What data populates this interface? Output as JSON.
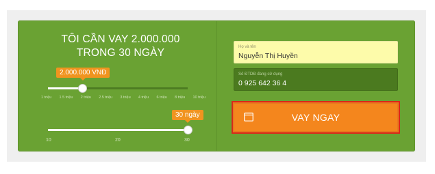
{
  "heading": {
    "line1": "TÔI CẦN VAY 2.000.000",
    "line2": "TRONG 30 NGÀY"
  },
  "amount_slider": {
    "bubble": "2.000.000 VNĐ",
    "ticks": [
      "1 triệu",
      "1.5 triệu",
      "2 triệu",
      "2.5 triệu",
      "3 triệu",
      "4 triệu",
      "6 triệu",
      "8 triệu",
      "10 triệu"
    ],
    "selected_index": 2
  },
  "days_slider": {
    "bubble": "30 ngày",
    "scale_labels": [
      "10",
      "20",
      "30"
    ],
    "level": 1.0
  },
  "form": {
    "name": {
      "label": "Họ và tên",
      "value": "Nguyễn Thị Huyền"
    },
    "phone": {
      "label": "Số ĐTDĐ đang sử dụng",
      "value": "0 925 642 36 4"
    },
    "submit_label": "VAY NGAY"
  },
  "colors": {
    "panel": "#6aa233",
    "accent": "#f4861d",
    "highlight_border": "#d9281a",
    "name_field": "#fdfbaa",
    "phone_field": "#4b7a1f"
  }
}
